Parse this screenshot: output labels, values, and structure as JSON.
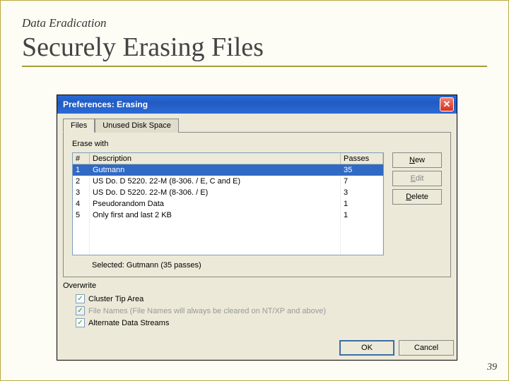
{
  "slide": {
    "eyebrow": "Data Eradication",
    "title": "Securely Erasing Files",
    "page": "39"
  },
  "window": {
    "title": "Preferences: Erasing",
    "close": "✕",
    "tabs": {
      "files": "Files",
      "unused": "Unused Disk Space"
    },
    "erase_with": "Erase with",
    "headers": {
      "num": "#",
      "desc": "Description",
      "passes": "Passes"
    },
    "rows": [
      {
        "n": "1",
        "d": "Gutmann",
        "p": "35"
      },
      {
        "n": "2",
        "d": "US Do. D 5220. 22-M (8-306. / E, C and E)",
        "p": "7"
      },
      {
        "n": "3",
        "d": "US Do. D 5220. 22-M (8-306. / E)",
        "p": "3"
      },
      {
        "n": "4",
        "d": "Pseudorandom Data",
        "p": "1"
      },
      {
        "n": "5",
        "d": "Only first and last 2 KB",
        "p": "1"
      }
    ],
    "buttons": {
      "new": "ew",
      "new_u": "N",
      "edit": "dit",
      "edit_u": "E",
      "delete": "elete",
      "delete_u": "D"
    },
    "selected": "Selected: Gutmann (35 passes)",
    "overwrite": "Overwrite",
    "cb1": "Cluster Tip Area",
    "cb2": "File Names (File Names will always be cleared on NT/XP and above)",
    "cb3": "Alternate Data Streams",
    "ok": "OK",
    "cancel": "Cancel"
  }
}
